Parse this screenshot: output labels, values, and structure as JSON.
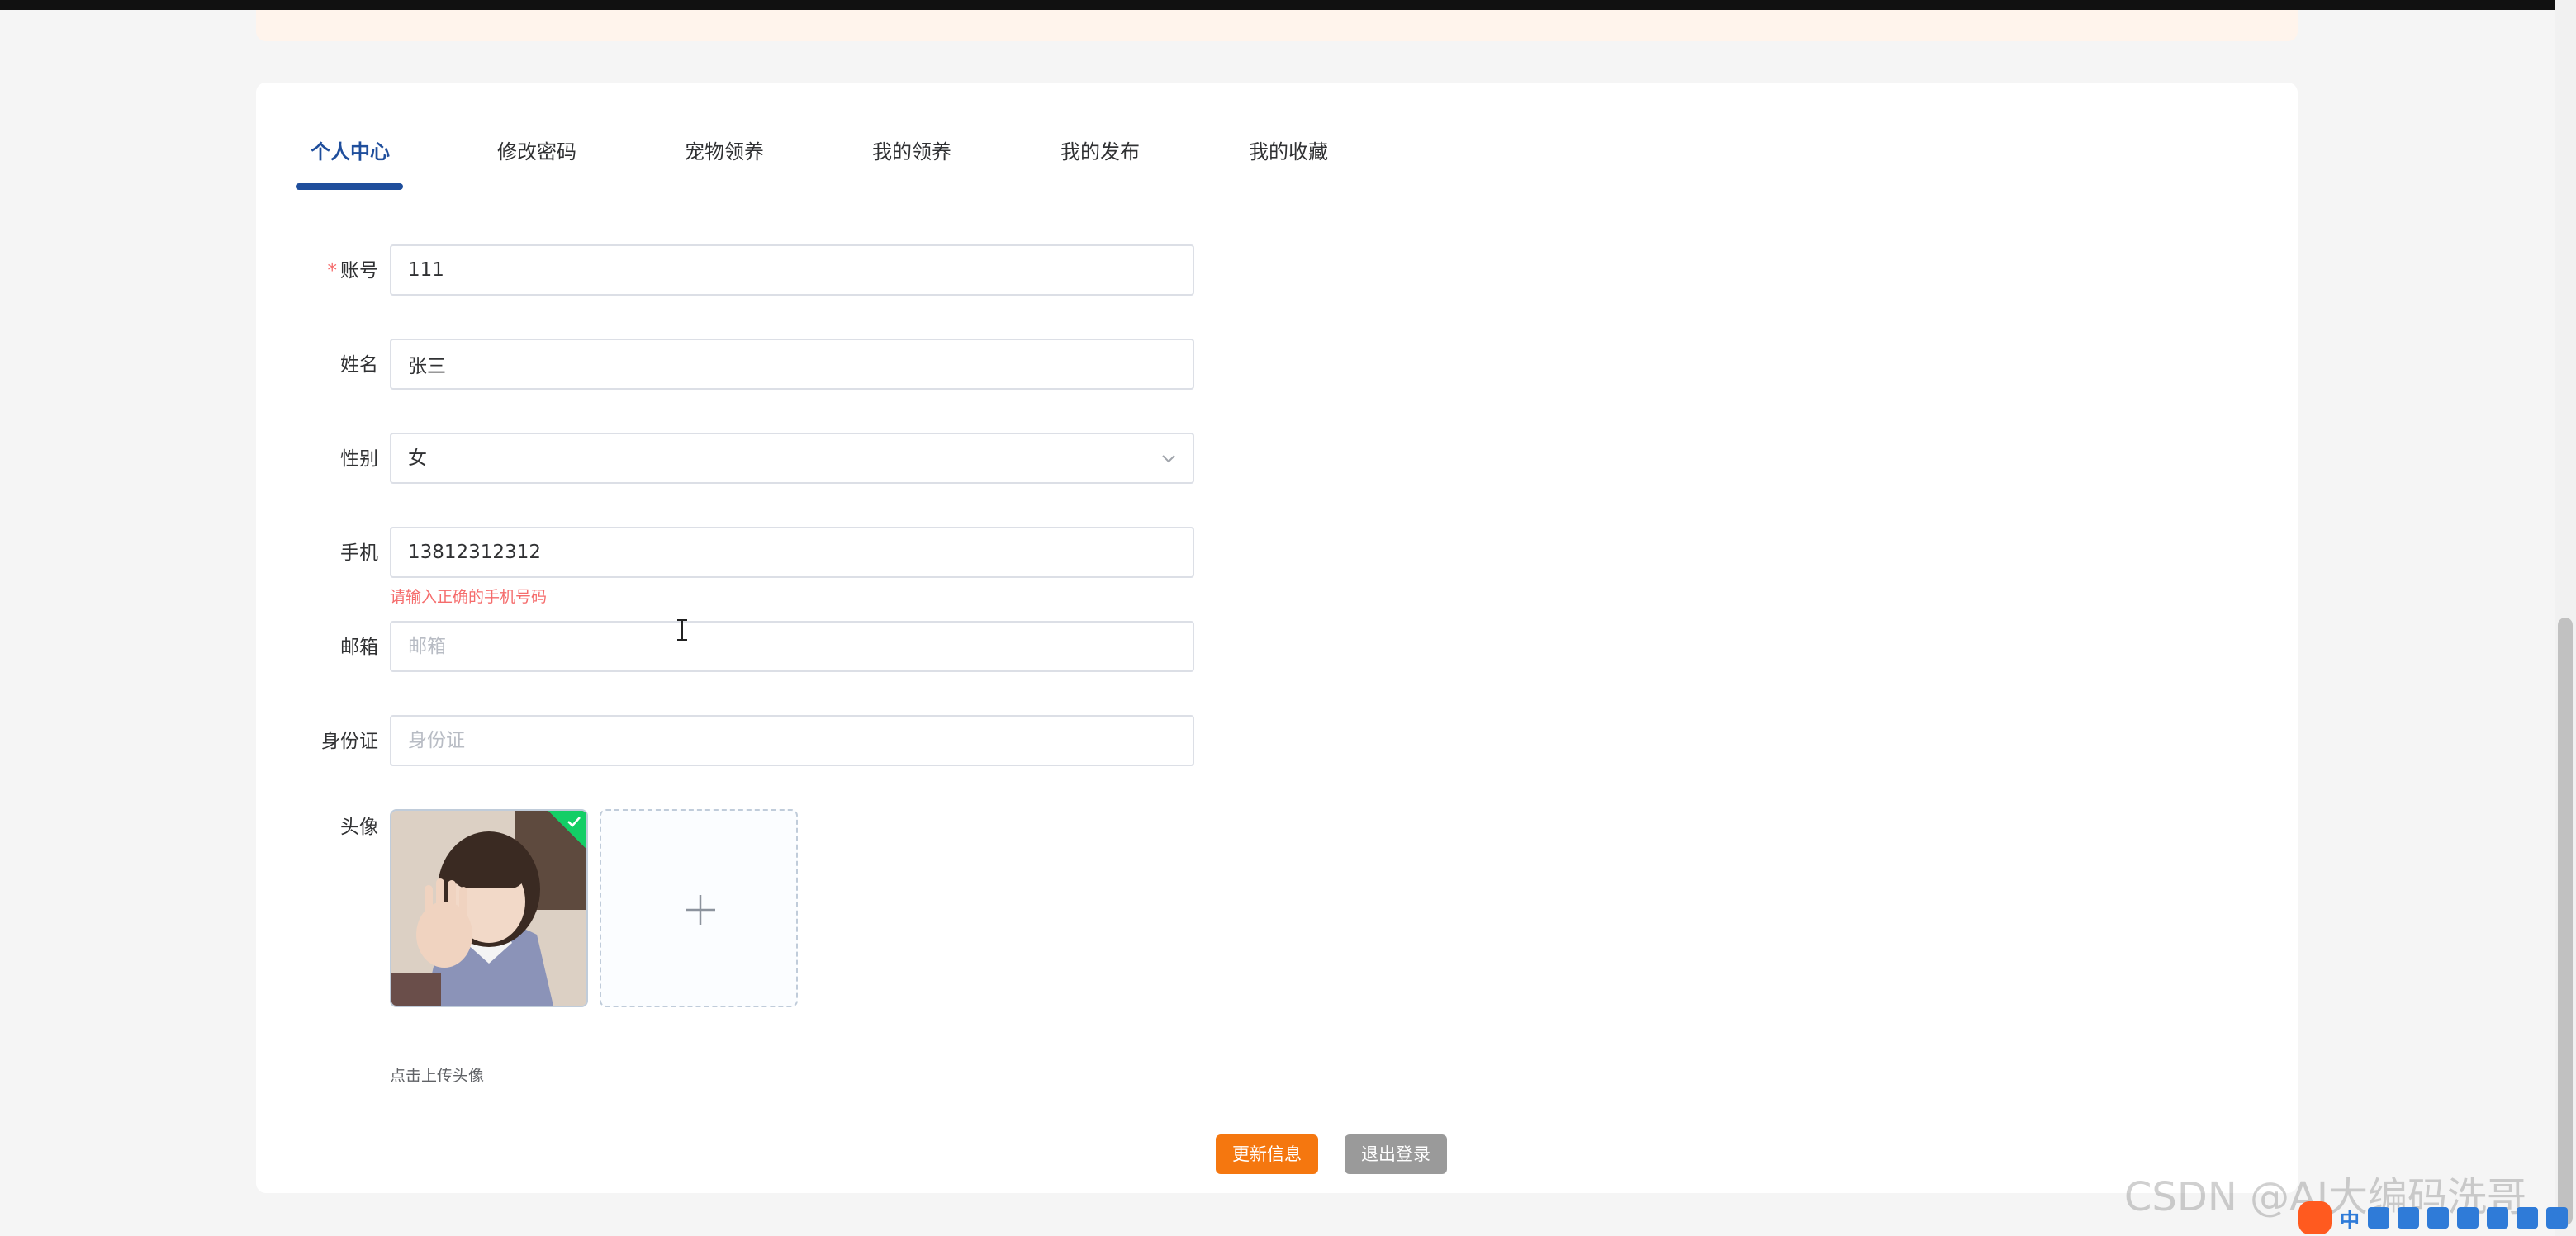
{
  "tabs": [
    {
      "label": "个人中心",
      "active": true
    },
    {
      "label": "修改密码",
      "active": false
    },
    {
      "label": "宠物领养",
      "active": false
    },
    {
      "label": "我的领养",
      "active": false
    },
    {
      "label": "我的发布",
      "active": false
    },
    {
      "label": "我的收藏",
      "active": false
    }
  ],
  "form": {
    "account": {
      "required_mark": "*",
      "label": "账号",
      "value": "111"
    },
    "name": {
      "label": "姓名",
      "value": "张三"
    },
    "gender": {
      "label": "性别",
      "value": "女"
    },
    "phone": {
      "label": "手机",
      "value": "13812312312",
      "error": "请输入正确的手机号码"
    },
    "email": {
      "label": "邮箱",
      "placeholder": "邮箱",
      "value": ""
    },
    "id_card": {
      "label": "身份证",
      "placeholder": "身份证",
      "value": ""
    },
    "avatar": {
      "label": "头像",
      "hint": "点击上传头像"
    }
  },
  "buttons": {
    "update": "更新信息",
    "logout": "退出登录"
  },
  "colors": {
    "active_tab": "#1f4e9c",
    "primary_button": "#f5770f",
    "secondary_button": "#9a9a9a",
    "error": "#f56c6c",
    "upload_success": "#13ce66"
  },
  "watermark": "CSDN @AI大编码洗哥",
  "tray": {
    "ime_text": "中"
  }
}
